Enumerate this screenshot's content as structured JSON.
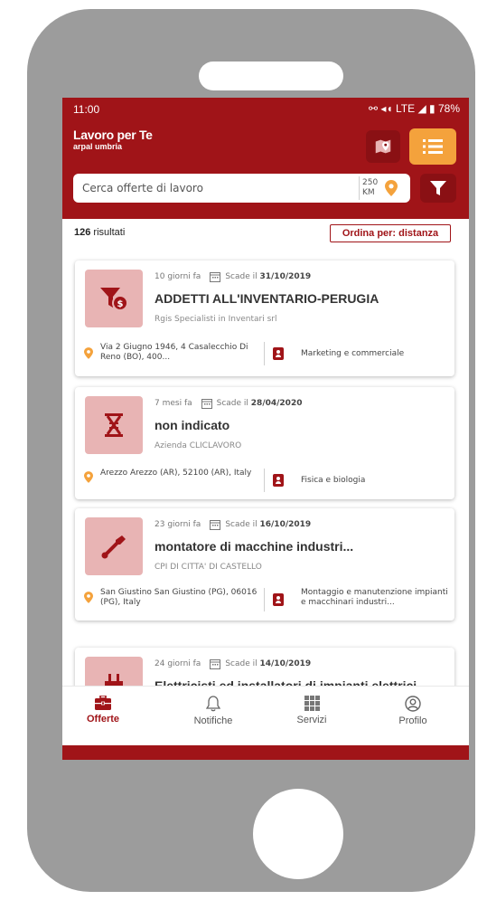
{
  "status": {
    "time": "11:00",
    "icons_text": "⚯ ◂◖ LTE ◢ ▮ 78%"
  },
  "brand": {
    "title": "Lavoro per Te",
    "subtitle": "arpal umbria"
  },
  "search": {
    "placeholder": "Cerca offerte di lavoro",
    "radius_value": "250",
    "radius_unit": "KM"
  },
  "results": {
    "count": "126",
    "label": "risultati"
  },
  "sort": {
    "label": "Ordina per: distanza"
  },
  "jobs": [
    {
      "posted": "10 giorni fa",
      "deadline_prefix": "Scade il",
      "deadline": "31/10/2019",
      "title": "ADDETTI ALL'INVENTARIO-PERUGIA",
      "company": "Rgis Specialisti in Inventari srl",
      "location": "Via 2 Giugno 1946, 4 Casalecchio Di Reno (BO), 400...",
      "category": "Marketing e commerciale",
      "icon": "funnel-money-icon"
    },
    {
      "posted": "7 mesi fa",
      "deadline_prefix": "Scade il",
      "deadline": "28/04/2020",
      "title": "non indicato",
      "company": "Azienda CLICLAVORO",
      "location": "Arezzo Arezzo (AR), 52100 (AR), Italy",
      "category": "Fisica e biologia",
      "icon": "dna-icon"
    },
    {
      "posted": "23 giorni fa",
      "deadline_prefix": "Scade il",
      "deadline": "16/10/2019",
      "title": "montatore di macchine industri...",
      "company": "CPI DI CITTA' DI CASTELLO",
      "location": "San Giustino San Giustino (PG), 06016 (PG), Italy",
      "category": "Montaggio e manutenzione impianti e macchinari industri...",
      "icon": "wrench-icon"
    },
    {
      "posted": "24 giorni fa",
      "deadline_prefix": "Scade il",
      "deadline": "14/10/2019",
      "title": "Elettricisti ed installatori di impianti elettrici",
      "icon": "plug-icon"
    }
  ],
  "nav": [
    {
      "label": "Offerte",
      "icon": "briefcase-icon"
    },
    {
      "label": "Notifiche",
      "icon": "bell-icon"
    },
    {
      "label": "Servizi",
      "icon": "grid-icon"
    },
    {
      "label": "Profilo",
      "icon": "user-circle-icon"
    }
  ],
  "colors": {
    "primary": "#a01418",
    "accent": "#f4a23c",
    "thumb": "#e8b4b4",
    "device": "#9c9c9c"
  }
}
